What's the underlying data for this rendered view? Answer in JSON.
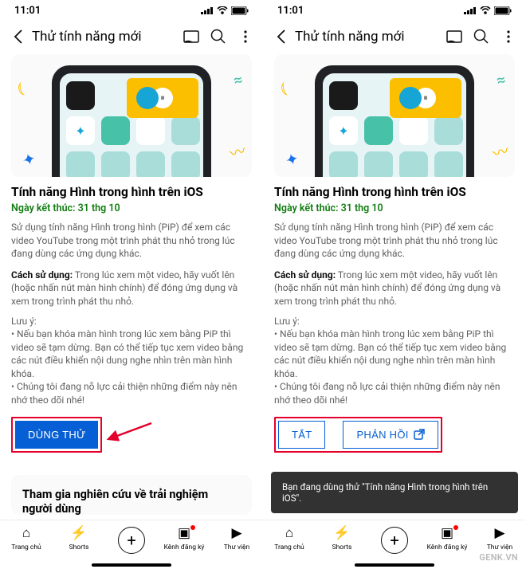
{
  "status": {
    "time": "11:01"
  },
  "header": {
    "title": "Thử tính năng mới"
  },
  "feature": {
    "title": "Tính năng Hình trong hình trên iOS",
    "end_date": "Ngày kết thúc: 31 thg 10",
    "description": "Sử dụng tính năng Hình trong hình (PiP) để xem các video YouTube trong một trình phát thu nhỏ trong lúc đang dùng các ứng dụng khác.",
    "howto_label": "Cách sử dụng:",
    "howto": "Trong lúc xem một video, hãy vuốt lên (hoặc nhấn nút màn hình chính) để đóng ứng dụng và xem trong trình phát thu nhỏ.",
    "note_label": "Lưu ý:",
    "bullet1": "• Nếu bạn khóa màn hình trong lúc xem bằng PiP thì video sẽ tạm dừng. Bạn có thể tiếp tục xem video bằng các nút điều khiển nội dung nghe nhìn trên màn hình khóa.",
    "bullet2": "• Chúng tôi đang nỗ lực cải thiện những điểm này nên nhớ theo dõi nhé!",
    "btn_try": "DÙNG THỬ",
    "btn_off": "TẮT",
    "btn_feedback": "PHẢN HỒI"
  },
  "second_card": {
    "title": "Tham gia nghiên cứu về trải nghiệm người dùng"
  },
  "toast": {
    "text": "Bạn đang dùng thử \"Tính năng Hình trong hình trên iOS\"."
  },
  "nav": {
    "home": "Trang chủ",
    "shorts": "Shorts",
    "subs": "Kênh đăng ký",
    "library": "Thư viện"
  },
  "watermark": "GENK.VN"
}
